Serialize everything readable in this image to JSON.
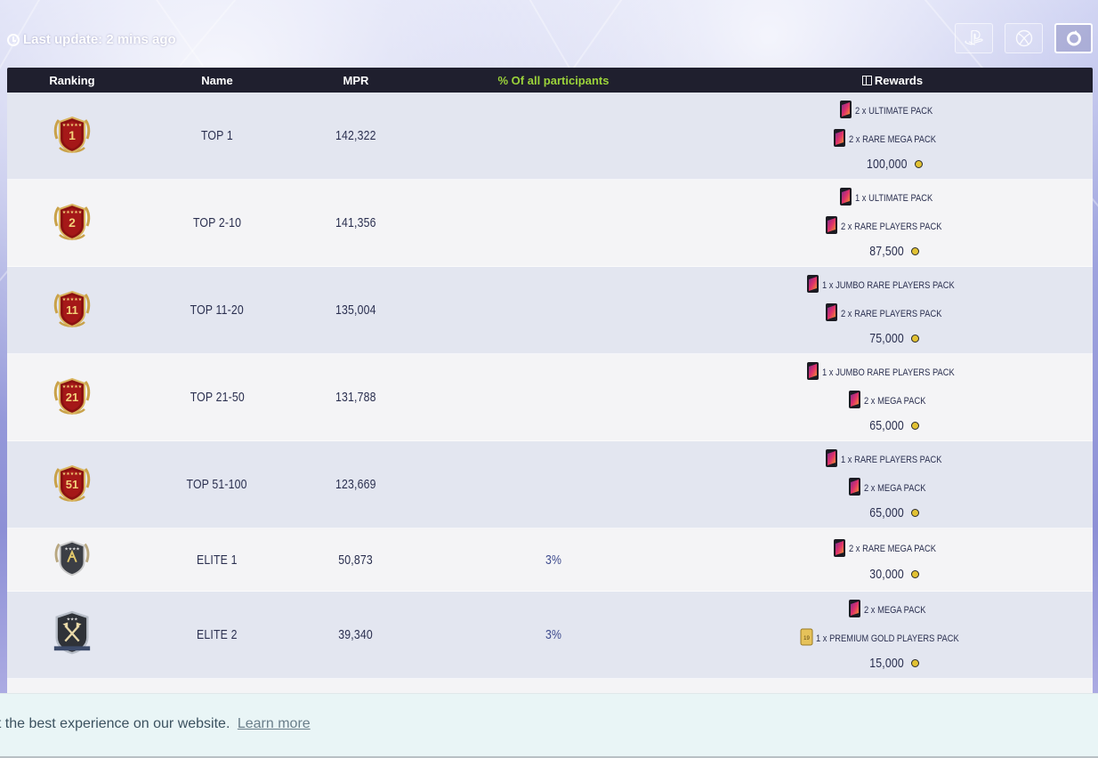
{
  "header": {
    "last_update": "Last update: 2 mins ago",
    "platforms": [
      {
        "name": "playstation-icon",
        "active": false
      },
      {
        "name": "xbox-icon",
        "active": false
      },
      {
        "name": "origin-icon",
        "active": true
      }
    ]
  },
  "table": {
    "columns": {
      "ranking": "Ranking",
      "name": "Name",
      "mpr": "MPR",
      "pct": "% Of all participants",
      "rewards": "Rewards"
    },
    "rows": [
      {
        "badge": "1",
        "badge_type": "red",
        "name": "TOP 1",
        "mpr": "142,322",
        "pct": "",
        "rewards": [
          {
            "icon": "ultimate-pack-icon",
            "text": "2 x ULTIMATE PACK"
          },
          {
            "icon": "rare-mega-pack-icon",
            "text": "2 x RARE MEGA PACK"
          }
        ],
        "coins": "100,000"
      },
      {
        "badge": "2",
        "badge_type": "red",
        "name": "TOP 2-10",
        "mpr": "141,356",
        "pct": "",
        "rewards": [
          {
            "icon": "ultimate-pack-icon",
            "text": "1 x ULTIMATE PACK"
          },
          {
            "icon": "rare-players-pack-icon",
            "text": "2 x RARE PLAYERS PACK"
          }
        ],
        "coins": "87,500"
      },
      {
        "badge": "11",
        "badge_type": "red",
        "name": "TOP 11-20",
        "mpr": "135,004",
        "pct": "",
        "rewards": [
          {
            "icon": "jumbo-rare-players-pack-icon",
            "text": "1 x JUMBO RARE PLAYERS PACK"
          },
          {
            "icon": "rare-players-pack-icon",
            "text": "2 x RARE PLAYERS PACK"
          }
        ],
        "coins": "75,000"
      },
      {
        "badge": "21",
        "badge_type": "red",
        "name": "TOP 21-50",
        "mpr": "131,788",
        "pct": "",
        "rewards": [
          {
            "icon": "jumbo-rare-players-pack-icon",
            "text": "1 x JUMBO RARE PLAYERS PACK"
          },
          {
            "icon": "mega-pack-icon",
            "text": "2 x MEGA PACK"
          }
        ],
        "coins": "65,000"
      },
      {
        "badge": "51",
        "badge_type": "red",
        "name": "TOP 51-100",
        "mpr": "123,669",
        "pct": "",
        "rewards": [
          {
            "icon": "rare-players-pack-icon",
            "text": "1 x RARE PLAYERS PACK"
          },
          {
            "icon": "mega-pack-icon",
            "text": "2 x MEGA PACK"
          }
        ],
        "coins": "65,000"
      },
      {
        "badge": "",
        "badge_type": "elite1",
        "name": "ELITE 1",
        "mpr": "50,873",
        "pct": "3%",
        "rewards": [
          {
            "icon": "rare-mega-pack-icon",
            "text": "2 x RARE MEGA PACK"
          }
        ],
        "coins": "30,000"
      },
      {
        "badge": "",
        "badge_type": "elite2",
        "name": "ELITE 2",
        "mpr": "39,340",
        "pct": "3%",
        "rewards": [
          {
            "icon": "mega-pack-icon",
            "text": "2 x MEGA PACK"
          },
          {
            "icon": "premium-gold-players-pack-icon",
            "text": "1 x PREMIUM GOLD PLAYERS PACK"
          }
        ],
        "coins": "15,000"
      }
    ]
  },
  "cookie": {
    "text": "et the best experience on our website.",
    "link": "Learn more"
  },
  "colors": {
    "header_bg": "#1f1f2e",
    "pct_header": "#9bd33a",
    "row_odd": "#e3e6f0",
    "row_even": "#f4f4f6",
    "cookie_bg": "#e9f5f6"
  }
}
